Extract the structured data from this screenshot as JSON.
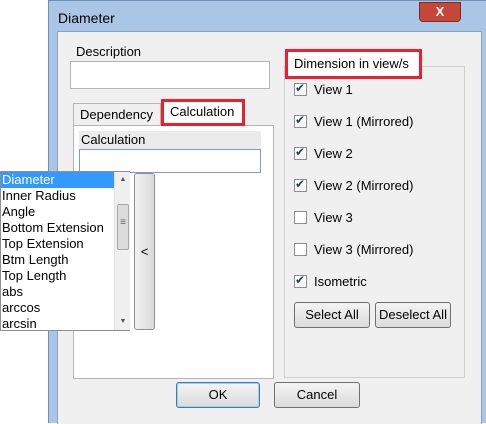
{
  "window": {
    "title": "Diameter",
    "close_glyph": "X"
  },
  "description": {
    "label": "Description",
    "value": ""
  },
  "tabs": [
    {
      "label": "Dependency",
      "active": false
    },
    {
      "label": "Calculation",
      "active": true
    }
  ],
  "calculation": {
    "header": "Calculation",
    "value": ""
  },
  "dimension": {
    "title": "Dimension in view/s",
    "views": [
      {
        "label": "View 1",
        "checked": true
      },
      {
        "label": "View 1 (Mirrored)",
        "checked": true
      },
      {
        "label": "View 2",
        "checked": true
      },
      {
        "label": "View 2 (Mirrored)",
        "checked": true
      },
      {
        "label": "View 3",
        "checked": false
      },
      {
        "label": "View 3 (Mirrored)",
        "checked": false
      },
      {
        "label": "Isometric",
        "checked": true
      }
    ],
    "select_all": "Select All",
    "deselect_all": "Deselect All"
  },
  "dropdown": {
    "items": [
      "Diameter",
      "Inner Radius",
      "Angle",
      "Bottom Extension",
      "Top Extension",
      "Btm Length",
      "Top Length",
      "abs",
      "arccos",
      "arcsin"
    ],
    "selected": "Diameter",
    "insert_label": "<"
  },
  "buttons": {
    "ok": "OK",
    "cancel": "Cancel"
  },
  "colors": {
    "highlight_border": "#e8212e",
    "selection": "#3399ff",
    "titlebar": "#aac6e6",
    "close": "#c7463a"
  }
}
